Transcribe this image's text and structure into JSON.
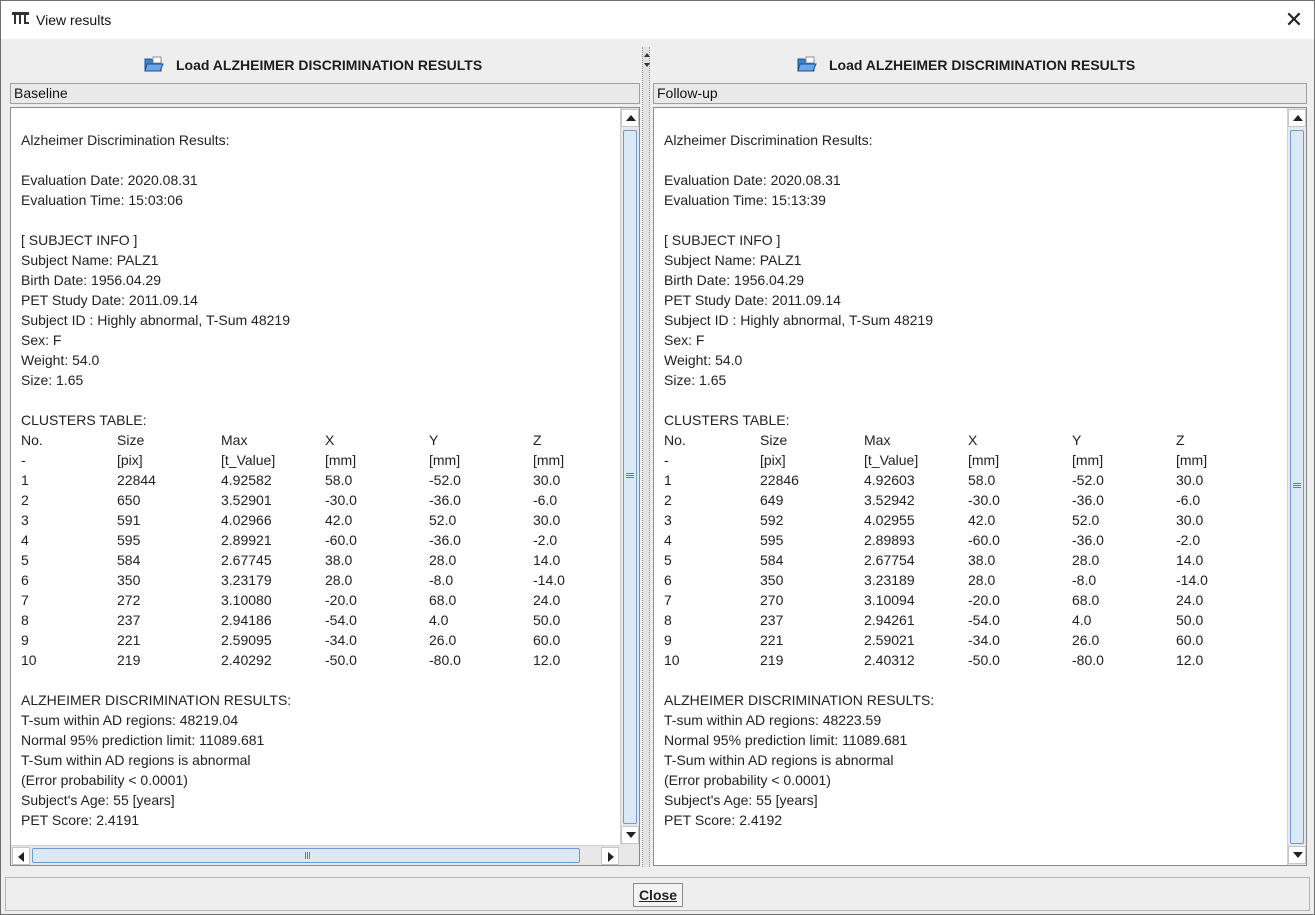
{
  "window": {
    "title": "View results",
    "app_icon": "pmod-icon",
    "close_icon": "close-icon"
  },
  "left": {
    "load_label": "Load ALZHEIMER DISCRIMINATION RESULTS",
    "section_label": "Baseline",
    "report": {
      "heading": "Alzheimer Discrimination Results:",
      "eval_date": "Evaluation Date: 2020.08.31",
      "eval_time": "Evaluation Time: 15:03:06",
      "subject_header": "[ SUBJECT INFO ]",
      "subject_name": "Subject Name: PALZ1",
      "birth_date": "Birth Date: 1956.04.29",
      "pet_date": "PET Study Date: 2011.09.14",
      "subject_id": "Subject ID : Highly abnormal, T-Sum 48219",
      "sex": "Sex: F",
      "weight": "Weight: 54.0",
      "size": "Size: 1.65",
      "clusters_header": "CLUSTERS TABLE:",
      "table_header": [
        "No.",
        "Size",
        "Max",
        "X",
        "Y",
        "Z"
      ],
      "table_units": [
        "-",
        "[pix]",
        "[t_Value]",
        "[mm]",
        "[mm]",
        "[mm]"
      ],
      "rows": [
        [
          "1",
          "22844",
          "4.92582",
          "58.0",
          "-52.0",
          "30.0"
        ],
        [
          "2",
          "650",
          "3.52901",
          "-30.0",
          "-36.0",
          "-6.0"
        ],
        [
          "3",
          "591",
          "4.02966",
          "42.0",
          "52.0",
          "30.0"
        ],
        [
          "4",
          "595",
          "2.89921",
          "-60.0",
          "-36.0",
          "-2.0"
        ],
        [
          "5",
          "584",
          "2.67745",
          "38.0",
          "28.0",
          "14.0"
        ],
        [
          "6",
          "350",
          "3.23179",
          "28.0",
          "-8.0",
          "-14.0"
        ],
        [
          "7",
          "272",
          "3.10080",
          "-20.0",
          "68.0",
          "24.0"
        ],
        [
          "8",
          "237",
          "2.94186",
          "-54.0",
          "4.0",
          "50.0"
        ],
        [
          "9",
          "221",
          "2.59095",
          "-34.0",
          "26.0",
          "60.0"
        ],
        [
          "10",
          "219",
          "2.40292",
          "-50.0",
          "-80.0",
          "12.0"
        ]
      ],
      "results_header": "ALZHEIMER DISCRIMINATION RESULTS:",
      "tsum": "T-sum within AD regions: 48219.04",
      "limit": "Normal 95% prediction limit: 11089.681",
      "abnormal": "T-Sum within AD regions is abnormal",
      "error_prob": "(Error probability < 0.0001)",
      "age": "Subject's Age: 55 [years]",
      "pet_score": "PET Score: 2.4191"
    }
  },
  "right": {
    "load_label": "Load ALZHEIMER DISCRIMINATION RESULTS",
    "section_label": "Follow-up",
    "report": {
      "heading": "Alzheimer Discrimination Results:",
      "eval_date": "Evaluation Date: 2020.08.31",
      "eval_time": "Evaluation Time: 15:13:39",
      "subject_header": "[ SUBJECT INFO ]",
      "subject_name": "Subject Name: PALZ1",
      "birth_date": "Birth Date: 1956.04.29",
      "pet_date": "PET Study Date: 2011.09.14",
      "subject_id": "Subject ID : Highly abnormal, T-Sum 48219",
      "sex": "Sex: F",
      "weight": "Weight: 54.0",
      "size": "Size: 1.65",
      "clusters_header": "CLUSTERS TABLE:",
      "table_header": [
        "No.",
        "Size",
        "Max",
        "X",
        "Y",
        "Z"
      ],
      "table_units": [
        "-",
        "[pix]",
        "[t_Value]",
        "[mm]",
        "[mm]",
        "[mm]"
      ],
      "rows": [
        [
          "1",
          "22846",
          "4.92603",
          "58.0",
          "-52.0",
          "30.0"
        ],
        [
          "2",
          "649",
          "3.52942",
          "-30.0",
          "-36.0",
          "-6.0"
        ],
        [
          "3",
          "592",
          "4.02955",
          "42.0",
          "52.0",
          "30.0"
        ],
        [
          "4",
          "595",
          "2.89893",
          "-60.0",
          "-36.0",
          "-2.0"
        ],
        [
          "5",
          "584",
          "2.67754",
          "38.0",
          "28.0",
          "14.0"
        ],
        [
          "6",
          "350",
          "3.23189",
          "28.0",
          "-8.0",
          "-14.0"
        ],
        [
          "7",
          "270",
          "3.10094",
          "-20.0",
          "68.0",
          "24.0"
        ],
        [
          "8",
          "237",
          "2.94261",
          "-54.0",
          "4.0",
          "50.0"
        ],
        [
          "9",
          "221",
          "2.59021",
          "-34.0",
          "26.0",
          "60.0"
        ],
        [
          "10",
          "219",
          "2.40312",
          "-50.0",
          "-80.0",
          "12.0"
        ]
      ],
      "results_header": "ALZHEIMER DISCRIMINATION RESULTS:",
      "tsum": "T-sum within AD regions: 48223.59",
      "limit": "Normal 95% prediction limit: 11089.681",
      "abnormal": "T-Sum within AD regions is abnormal",
      "error_prob": "(Error probability < 0.0001)",
      "age": "Subject's Age: 55 [years]",
      "pet_score": "PET Score: 2.4192"
    }
  },
  "footer": {
    "close_label": "Close"
  },
  "colors": {
    "scroll_thumb": "#dbe8f6",
    "scroll_border": "#6f9bd0",
    "folder_blue": "#2b6cc4"
  }
}
